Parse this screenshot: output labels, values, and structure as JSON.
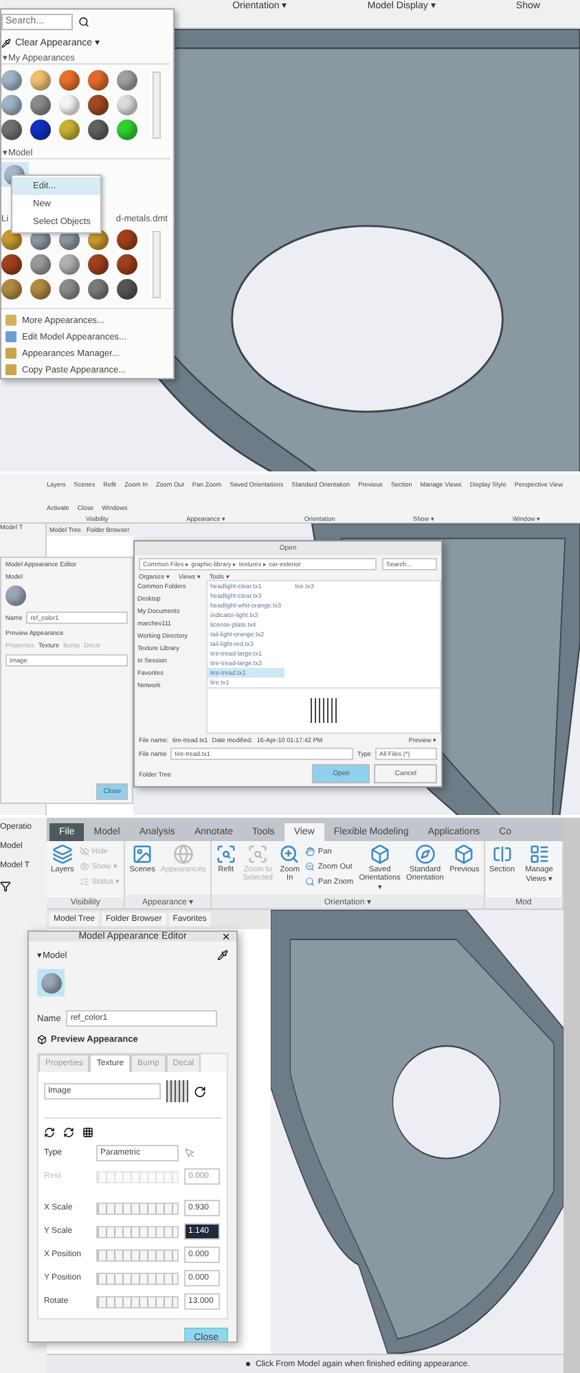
{
  "top_panel": {
    "ribbon_groups": [
      "Orientation ▾",
      "Model Display ▾",
      "Show"
    ],
    "appearance_menu": {
      "search_placeholder": "Search...",
      "clear_label": "Clear Appearance ▾",
      "my_title": "▾My Appearances",
      "my_swatches": [
        {
          "color": "#9fb3c6"
        },
        {
          "color": "#f0c070"
        },
        {
          "color": "#e8702a"
        },
        {
          "color": "#e06a2a"
        },
        {
          "color": "#a0a0a0"
        },
        {
          "color": "#9fb3c6"
        },
        {
          "color": "#8a8a8a"
        },
        {
          "color": "#f4f4f4"
        },
        {
          "color": "#a04a22"
        },
        {
          "color": "#dcdcdc"
        },
        {
          "color": "#707070"
        },
        {
          "color": "#1030c0"
        },
        {
          "color": "#c8b030"
        },
        {
          "color": "#606060"
        },
        {
          "color": "#30d030"
        }
      ],
      "model_title": "▾Model",
      "model_swatch": {
        "color": "#a8b8c8"
      },
      "context_menu": [
        {
          "label": "Edit...",
          "selected": true
        },
        {
          "label": "New",
          "selected": false
        },
        {
          "label": "Select Objects",
          "selected": false
        }
      ],
      "library_title_start": "Li",
      "library_title_end": "d-metals.dmt",
      "library_swatches": [
        {
          "color": "#c89a30"
        },
        {
          "color": "#8c98a4"
        },
        {
          "color": "#8c98a4"
        },
        {
          "color": "#c89a30"
        },
        {
          "color": "#a0401c"
        },
        {
          "color": "#a0401c"
        },
        {
          "color": "#9a9a9a"
        },
        {
          "color": "#b0b0b0"
        },
        {
          "color": "#a0401c"
        },
        {
          "color": "#a0401c"
        },
        {
          "color": "#b08a40"
        },
        {
          "color": "#b08a40"
        },
        {
          "color": "#8a8a8a"
        },
        {
          "color": "#7a7a7a"
        },
        {
          "color": "#555555"
        }
      ],
      "actions": [
        "More Appearances...",
        "Edit Model Appearances...",
        "Appearances Manager...",
        "Copy Paste Appearance..."
      ]
    }
  },
  "middle_panel": {
    "left_tabs": [
      "Model T"
    ],
    "ribbon_items": [
      "Layers",
      "Scenes",
      "Refit",
      "Zoom In",
      "Zoom Out",
      "Pan Zoom",
      "Saved Orientations",
      "Standard Orientation",
      "Previous",
      "Section",
      "Manage Views",
      "Display Style",
      "Perspective View",
      "Activate",
      "Close",
      "Windows"
    ],
    "ribbon_groups": [
      "Visibility",
      "Appearance ▾",
      "Orientation",
      "Show ▾",
      "Window ▾"
    ],
    "tree_tabs": [
      "Model Tree",
      "Folder Browser"
    ],
    "editor": {
      "title": "Model Appearance Editor",
      "model_label": "Model",
      "name_label": "Name",
      "name_value": "ref_color1",
      "preview_label": "Preview Appearance",
      "tabs": [
        {
          "label": "Properties",
          "selected": false
        },
        {
          "label": "Texture",
          "selected": true
        },
        {
          "label": "Bump",
          "selected": false
        },
        {
          "label": "Decal",
          "selected": false
        }
      ],
      "image_option": "Image",
      "close_label": "Close"
    },
    "open_dialog": {
      "title": "Open",
      "path": "Common Files ▸ graphic-library ▸ textures ▸ car-exterior",
      "search_placeholder": "Search...",
      "toolbar": [
        "Organize ▾",
        "Views ▾",
        "Tools ▾"
      ],
      "folders_title": "Common Folders",
      "folders": [
        "Desktop",
        "My Documents",
        "marchev111",
        "Working Directory",
        "Texture Library",
        "In Session",
        "Favorites",
        "Network"
      ],
      "files": [
        {
          "name": "headlight-clear.tx1",
          "selected": false
        },
        {
          "name": "headlight-clear.tx3",
          "selected": false
        },
        {
          "name": "headlight-whit-orange.tx3",
          "selected": false
        },
        {
          "name": "indicator-light.tx3",
          "selected": false
        },
        {
          "name": "license-plate.tx4",
          "selected": false
        },
        {
          "name": "tail-light-orange.tx2",
          "selected": false
        },
        {
          "name": "tail-light-red.tx3",
          "selected": false
        },
        {
          "name": "tire-tread-large.tx1",
          "selected": false
        },
        {
          "name": "tire-tread-large.tx3",
          "selected": false
        },
        {
          "name": "tire-tread.tx1",
          "selected": true
        },
        {
          "name": "tire.tx1",
          "selected": false
        },
        {
          "name": "tire.tx3",
          "selected": false
        }
      ],
      "info_name_label": "File name:",
      "info_name": "tire-tread.tx1",
      "info_date_label": "Date modified:",
      "info_date": "16-Apr-10 01:17:42 PM",
      "preview_label": "Preview ▾",
      "file_name_label": "File name",
      "file_name_value": "tire-tread.tx1",
      "type_label": "Type",
      "type_value": "All Files (*)",
      "folder_tree_label": "Folder Tree",
      "open_label": "Open",
      "cancel_label": "Cancel"
    }
  },
  "bottom_panel": {
    "left_strip": [
      "Operatio",
      "Model",
      "Model T"
    ],
    "tabs": [
      {
        "label": "File",
        "selected": false,
        "kind": "file"
      },
      {
        "label": "Model",
        "selected": false,
        "kind": "tab"
      },
      {
        "label": "Analysis",
        "selected": false,
        "kind": "tab"
      },
      {
        "label": "Annotate",
        "selected": false,
        "kind": "tab"
      },
      {
        "label": "Tools",
        "selected": false,
        "kind": "tab"
      },
      {
        "label": "View",
        "selected": true,
        "kind": "tab"
      },
      {
        "label": "Flexible Modeling",
        "selected": false,
        "kind": "tab"
      },
      {
        "label": "Applications",
        "selected": false,
        "kind": "tab"
      },
      {
        "label": "Co",
        "selected": false,
        "kind": "tab"
      }
    ],
    "groups": [
      {
        "label": "Visibility",
        "items": [
          {
            "label": "Layers",
            "kind": "large",
            "disabled": false
          },
          {
            "label": "Hide",
            "kind": "small",
            "disabled": true
          },
          {
            "label": "Show ▾",
            "kind": "small",
            "disabled": true
          },
          {
            "label": "Status ▾",
            "kind": "small",
            "disabled": true
          }
        ]
      },
      {
        "label": "Appearance ▾",
        "items": [
          {
            "label": "Scenes",
            "kind": "large",
            "disabled": false
          },
          {
            "label": "Appearances",
            "kind": "large",
            "disabled": true
          }
        ]
      },
      {
        "label": "Orientation ▾",
        "items": [
          {
            "label": "Refit",
            "kind": "large",
            "disabled": false
          },
          {
            "label": "Zoom to Selected",
            "kind": "large",
            "disabled": true
          },
          {
            "label": "Zoom In",
            "kind": "large",
            "disabled": false
          },
          {
            "label": "Pan",
            "kind": "small",
            "disabled": false
          },
          {
            "label": "Zoom Out",
            "kind": "small",
            "disabled": false
          },
          {
            "label": "Pan Zoom",
            "kind": "small",
            "disabled": false
          },
          {
            "label": "Saved Orientations ▾",
            "kind": "large",
            "disabled": false
          },
          {
            "label": "Standard Orientation",
            "kind": "large",
            "disabled": false
          },
          {
            "label": "Previous",
            "kind": "large",
            "disabled": false
          }
        ]
      },
      {
        "label": "Mod",
        "items": [
          {
            "label": "Section",
            "kind": "large",
            "disabled": false
          },
          {
            "label": "Manage Views ▾",
            "kind": "large",
            "disabled": false
          }
        ]
      }
    ],
    "tree_tabs": [
      "Model Tree",
      "Folder Browser",
      "Favorites"
    ],
    "editor": {
      "title": "Model Appearance Editor",
      "model_label": "▾Model",
      "name_label": "Name",
      "name_value": "ref_color1",
      "preview_label": "Preview Appearance",
      "tabs": [
        {
          "label": "Properties",
          "selected": false
        },
        {
          "label": "Texture",
          "selected": true
        },
        {
          "label": "Bump",
          "selected": false
        },
        {
          "label": "Decal",
          "selected": false
        }
      ],
      "image_option": "Image",
      "type_label": "Type",
      "type_value": "Parametric",
      "params": [
        {
          "label": "Rest",
          "value": "0.000",
          "disabled": true,
          "selected": false
        },
        {
          "label": "X Scale",
          "value": "0.930",
          "disabled": false,
          "selected": false
        },
        {
          "label": "Y Scale",
          "value": "1.140",
          "disabled": false,
          "selected": true
        },
        {
          "label": "X Position",
          "value": "0.000",
          "disabled": false,
          "selected": false
        },
        {
          "label": "Y Position",
          "value": "0.000",
          "disabled": false,
          "selected": false
        },
        {
          "label": "Rotate",
          "value": "13.000",
          "disabled": false,
          "selected": false
        }
      ],
      "close_label": "Close"
    },
    "status_message": "Click From Model again when finished editing appearance."
  }
}
